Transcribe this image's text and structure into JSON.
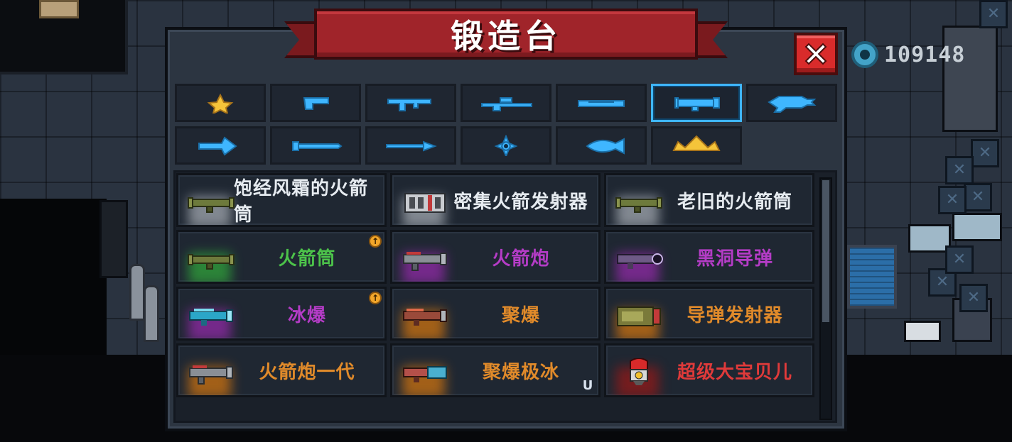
{
  "forge": {
    "title": "锻造台",
    "close_label": "✕"
  },
  "gems": {
    "count": "109148",
    "icon": "gem-icon",
    "color": "#43a3c8"
  },
  "categories": [
    {
      "id": "favorites",
      "icon": "star-icon",
      "active": false
    },
    {
      "id": "pistol",
      "icon": "pistol-icon",
      "active": false
    },
    {
      "id": "rifle",
      "icon": "rifle-icon",
      "active": false
    },
    {
      "id": "sniper",
      "icon": "sniper-icon",
      "active": false
    },
    {
      "id": "shotgun",
      "icon": "shotgun-icon",
      "active": false
    },
    {
      "id": "launcher",
      "icon": "launcher-icon",
      "active": true
    },
    {
      "id": "laser",
      "icon": "laser-gun-icon",
      "active": false
    },
    {
      "id": "bow",
      "icon": "bow-icon",
      "active": false
    },
    {
      "id": "sword",
      "icon": "sword-icon",
      "active": false
    },
    {
      "id": "spear",
      "icon": "spear-icon",
      "active": false
    },
    {
      "id": "throwable",
      "icon": "shuriken-icon",
      "active": false
    },
    {
      "id": "fish",
      "icon": "fish-icon",
      "active": false
    },
    {
      "id": "crown",
      "icon": "crown-icon",
      "active": false
    }
  ],
  "weapons": [
    {
      "name": "饱经风霜的火箭筒",
      "color": "#e6ebf0",
      "glow": "#9aa0a8",
      "badge": false,
      "magnet": false,
      "icon": "bazooka-icon"
    },
    {
      "name": "密集火箭发射器",
      "color": "#e6ebf0",
      "glow": "#9aa0a8",
      "badge": false,
      "magnet": false,
      "icon": "rocket-pod-icon"
    },
    {
      "name": "老旧的火箭筒",
      "color": "#e6ebf0",
      "glow": "#9aa0a8",
      "badge": false,
      "magnet": false,
      "icon": "bazooka-icon"
    },
    {
      "name": "火箭筒",
      "color": "#4cc24a",
      "glow": "#2f9b3a",
      "badge": true,
      "magnet": false,
      "icon": "bazooka-icon"
    },
    {
      "name": "火箭炮",
      "color": "#b43cc6",
      "glow": "#8a2aa0",
      "badge": false,
      "magnet": false,
      "icon": "rocket-cannon-icon"
    },
    {
      "name": "黑洞导弹",
      "color": "#b43cc6",
      "glow": "#8a2aa0",
      "badge": false,
      "magnet": false,
      "icon": "blackhole-launcher-icon"
    },
    {
      "name": "冰爆",
      "color": "#b43cc6",
      "glow": "#8a2aa0",
      "badge": true,
      "magnet": false,
      "icon": "ice-launcher-icon"
    },
    {
      "name": "聚爆",
      "color": "#e08a2a",
      "glow": "#c36e12",
      "badge": false,
      "magnet": false,
      "icon": "implosion-launcher-icon"
    },
    {
      "name": "导弹发射器",
      "color": "#e08a2a",
      "glow": "#c36e12",
      "badge": false,
      "magnet": false,
      "icon": "missile-launcher-icon"
    },
    {
      "name": "火箭炮一代",
      "color": "#e08a2a",
      "glow": "#c36e12",
      "badge": false,
      "magnet": false,
      "icon": "rocket-cannon-icon"
    },
    {
      "name": "聚爆极冰",
      "color": "#e08a2a",
      "glow": "#c36e12",
      "badge": false,
      "magnet": true,
      "icon": "implosion-ice-icon"
    },
    {
      "name": "超级大宝贝儿",
      "color": "#e03a3a",
      "glow": "#8a1a1a",
      "badge": false,
      "magnet": false,
      "icon": "nuke-icon"
    }
  ]
}
